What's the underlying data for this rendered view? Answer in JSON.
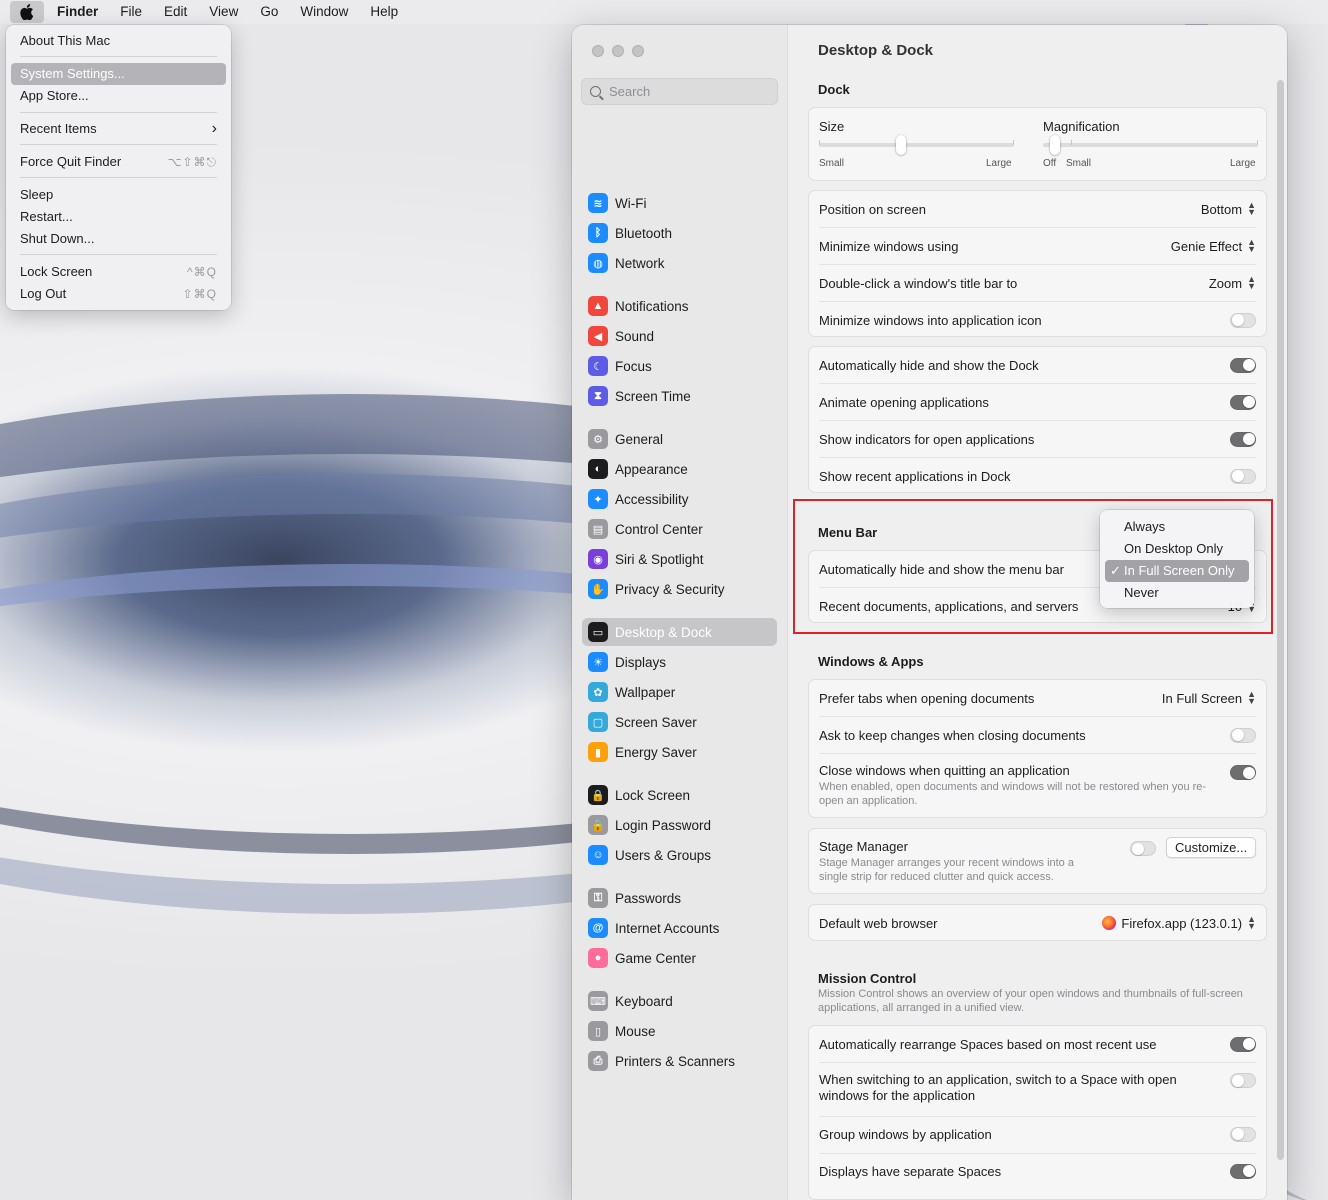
{
  "menubar": {
    "app": "Finder",
    "items": [
      "File",
      "Edit",
      "View",
      "Go",
      "Window",
      "Help"
    ]
  },
  "apple_menu": {
    "items": [
      {
        "label": "About This Mac",
        "shortcut": ""
      },
      {
        "label": "System Settings...",
        "shortcut": ""
      },
      {
        "label": "App Store...",
        "shortcut": ""
      },
      {
        "label": "Recent Items",
        "shortcut": "›"
      },
      {
        "label": "Force Quit Finder",
        "shortcut": "⌥⇧⌘⎋"
      },
      {
        "label": "Sleep",
        "shortcut": ""
      },
      {
        "label": "Restart...",
        "shortcut": ""
      },
      {
        "label": "Shut Down...",
        "shortcut": ""
      },
      {
        "label": "Lock Screen",
        "shortcut": "^⌘Q"
      },
      {
        "label": "Log Out",
        "shortcut": "⇧⌘Q"
      }
    ]
  },
  "sidebar": {
    "search_placeholder": "Search",
    "items": [
      {
        "label": "Wi-Fi",
        "icon": "wifi-icon",
        "color": "#1a8cff"
      },
      {
        "label": "Bluetooth",
        "icon": "bluetooth-icon",
        "color": "#1a8cff"
      },
      {
        "label": "Network",
        "icon": "globe-icon",
        "color": "#1a8cff"
      },
      {
        "label": "Notifications",
        "icon": "bell-icon",
        "color": "#f0463c"
      },
      {
        "label": "Sound",
        "icon": "speaker-icon",
        "color": "#f0463c"
      },
      {
        "label": "Focus",
        "icon": "moon-icon",
        "color": "#5e5ce6"
      },
      {
        "label": "Screen Time",
        "icon": "hourglass-icon",
        "color": "#5e5ce6"
      },
      {
        "label": "General",
        "icon": "gear-icon",
        "color": "#9a9a9e"
      },
      {
        "label": "Appearance",
        "icon": "appearance-icon",
        "color": "#1c1c1e"
      },
      {
        "label": "Accessibility",
        "icon": "accessibility-icon",
        "color": "#1a8cff"
      },
      {
        "label": "Control Center",
        "icon": "control-center-icon",
        "color": "#9a9a9e"
      },
      {
        "label": "Siri & Spotlight",
        "icon": "siri-icon",
        "color": "#7a3fd8"
      },
      {
        "label": "Privacy & Security",
        "icon": "hand-icon",
        "color": "#1a8cff"
      },
      {
        "label": "Desktop & Dock",
        "icon": "dock-icon",
        "color": "#1c1c1e"
      },
      {
        "label": "Displays",
        "icon": "sun-icon",
        "color": "#1a8cff"
      },
      {
        "label": "Wallpaper",
        "icon": "flower-icon",
        "color": "#34aadc"
      },
      {
        "label": "Screen Saver",
        "icon": "screensaver-icon",
        "color": "#34aadc"
      },
      {
        "label": "Energy Saver",
        "icon": "battery-icon",
        "color": "#ff9f0a"
      },
      {
        "label": "Lock Screen",
        "icon": "lock-icon",
        "color": "#1c1c1e"
      },
      {
        "label": "Login Password",
        "icon": "lock-icon",
        "color": "#9a9a9e"
      },
      {
        "label": "Users & Groups",
        "icon": "users-icon",
        "color": "#1a8cff"
      },
      {
        "label": "Passwords",
        "icon": "key-icon",
        "color": "#9a9a9e"
      },
      {
        "label": "Internet Accounts",
        "icon": "at-icon",
        "color": "#1a8cff"
      },
      {
        "label": "Game Center",
        "icon": "game-center-icon",
        "color": "#ff6b9a"
      },
      {
        "label": "Keyboard",
        "icon": "keyboard-icon",
        "color": "#9a9a9e"
      },
      {
        "label": "Mouse",
        "icon": "mouse-icon",
        "color": "#9a9a9e"
      },
      {
        "label": "Printers & Scanners",
        "icon": "printer-icon",
        "color": "#9a9a9e"
      }
    ]
  },
  "content": {
    "title": "Desktop & Dock",
    "dock": {
      "title": "Dock",
      "size_label": "Size",
      "size_small": "Small",
      "size_large": "Large",
      "size_value": 0.42,
      "mag_label": "Magnification",
      "mag_off": "Off",
      "mag_small": "Small",
      "mag_large": "Large",
      "mag_value": 0.0,
      "position_label": "Position on screen",
      "position_value": "Bottom",
      "minimize_label": "Minimize windows using",
      "minimize_value": "Genie Effect",
      "doubleclick_label": "Double-click a window's title bar to",
      "doubleclick_value": "Zoom",
      "minimize_icon_label": "Minimize windows into application icon",
      "autohide_label": "Automatically hide and show the Dock",
      "animate_label": "Animate opening applications",
      "indicators_label": "Show indicators for open applications",
      "recent_label": "Show recent applications in Dock"
    },
    "menubar": {
      "title": "Menu Bar",
      "autohide_label": "Automatically hide and show the menu bar",
      "recent_label": "Recent documents, applications, and servers",
      "recent_value": "10",
      "options": [
        "Always",
        "On Desktop Only",
        "In Full Screen Only",
        "Never"
      ],
      "selected": "In Full Screen Only",
      "check": "✓"
    },
    "windows": {
      "title": "Windows & Apps",
      "prefer_tabs_label": "Prefer tabs when opening documents",
      "prefer_tabs_value": "In Full Screen",
      "ask_keep_label": "Ask to keep changes when closing documents",
      "close_windows_label": "Close windows when quitting an application",
      "close_windows_sub": "When enabled, open documents and windows will not be restored when you re-open an application.",
      "stage_label": "Stage Manager",
      "stage_sub": "Stage Manager arranges your recent windows into a single strip for reduced clutter and quick access.",
      "customize": "Customize...",
      "browser_label": "Default web browser",
      "browser_value": "Firefox.app (123.0.1)"
    },
    "mission": {
      "title": "Mission Control",
      "sub": "Mission Control shows an overview of your open windows and thumbnails of full-screen applications, all arranged in a unified view.",
      "rearrange_label": "Automatically rearrange Spaces based on most recent use",
      "switch_label": "When switching to an application, switch to a Space with open windows for the application",
      "group_label": "Group windows by application",
      "separate_label": "Displays have separate Spaces"
    }
  }
}
